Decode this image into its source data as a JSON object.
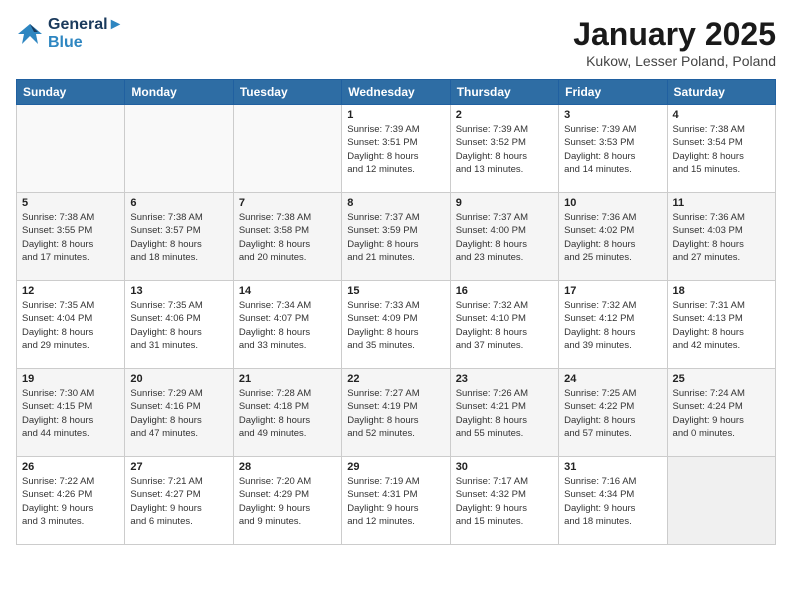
{
  "header": {
    "logo_line1": "General",
    "logo_line2": "Blue",
    "title": "January 2025",
    "subtitle": "Kukow, Lesser Poland, Poland"
  },
  "days_of_week": [
    "Sunday",
    "Monday",
    "Tuesday",
    "Wednesday",
    "Thursday",
    "Friday",
    "Saturday"
  ],
  "weeks": [
    [
      {
        "day": "",
        "info": ""
      },
      {
        "day": "",
        "info": ""
      },
      {
        "day": "",
        "info": ""
      },
      {
        "day": "1",
        "info": "Sunrise: 7:39 AM\nSunset: 3:51 PM\nDaylight: 8 hours\nand 12 minutes."
      },
      {
        "day": "2",
        "info": "Sunrise: 7:39 AM\nSunset: 3:52 PM\nDaylight: 8 hours\nand 13 minutes."
      },
      {
        "day": "3",
        "info": "Sunrise: 7:39 AM\nSunset: 3:53 PM\nDaylight: 8 hours\nand 14 minutes."
      },
      {
        "day": "4",
        "info": "Sunrise: 7:38 AM\nSunset: 3:54 PM\nDaylight: 8 hours\nand 15 minutes."
      }
    ],
    [
      {
        "day": "5",
        "info": "Sunrise: 7:38 AM\nSunset: 3:55 PM\nDaylight: 8 hours\nand 17 minutes."
      },
      {
        "day": "6",
        "info": "Sunrise: 7:38 AM\nSunset: 3:57 PM\nDaylight: 8 hours\nand 18 minutes."
      },
      {
        "day": "7",
        "info": "Sunrise: 7:38 AM\nSunset: 3:58 PM\nDaylight: 8 hours\nand 20 minutes."
      },
      {
        "day": "8",
        "info": "Sunrise: 7:37 AM\nSunset: 3:59 PM\nDaylight: 8 hours\nand 21 minutes."
      },
      {
        "day": "9",
        "info": "Sunrise: 7:37 AM\nSunset: 4:00 PM\nDaylight: 8 hours\nand 23 minutes."
      },
      {
        "day": "10",
        "info": "Sunrise: 7:36 AM\nSunset: 4:02 PM\nDaylight: 8 hours\nand 25 minutes."
      },
      {
        "day": "11",
        "info": "Sunrise: 7:36 AM\nSunset: 4:03 PM\nDaylight: 8 hours\nand 27 minutes."
      }
    ],
    [
      {
        "day": "12",
        "info": "Sunrise: 7:35 AM\nSunset: 4:04 PM\nDaylight: 8 hours\nand 29 minutes."
      },
      {
        "day": "13",
        "info": "Sunrise: 7:35 AM\nSunset: 4:06 PM\nDaylight: 8 hours\nand 31 minutes."
      },
      {
        "day": "14",
        "info": "Sunrise: 7:34 AM\nSunset: 4:07 PM\nDaylight: 8 hours\nand 33 minutes."
      },
      {
        "day": "15",
        "info": "Sunrise: 7:33 AM\nSunset: 4:09 PM\nDaylight: 8 hours\nand 35 minutes."
      },
      {
        "day": "16",
        "info": "Sunrise: 7:32 AM\nSunset: 4:10 PM\nDaylight: 8 hours\nand 37 minutes."
      },
      {
        "day": "17",
        "info": "Sunrise: 7:32 AM\nSunset: 4:12 PM\nDaylight: 8 hours\nand 39 minutes."
      },
      {
        "day": "18",
        "info": "Sunrise: 7:31 AM\nSunset: 4:13 PM\nDaylight: 8 hours\nand 42 minutes."
      }
    ],
    [
      {
        "day": "19",
        "info": "Sunrise: 7:30 AM\nSunset: 4:15 PM\nDaylight: 8 hours\nand 44 minutes."
      },
      {
        "day": "20",
        "info": "Sunrise: 7:29 AM\nSunset: 4:16 PM\nDaylight: 8 hours\nand 47 minutes."
      },
      {
        "day": "21",
        "info": "Sunrise: 7:28 AM\nSunset: 4:18 PM\nDaylight: 8 hours\nand 49 minutes."
      },
      {
        "day": "22",
        "info": "Sunrise: 7:27 AM\nSunset: 4:19 PM\nDaylight: 8 hours\nand 52 minutes."
      },
      {
        "day": "23",
        "info": "Sunrise: 7:26 AM\nSunset: 4:21 PM\nDaylight: 8 hours\nand 55 minutes."
      },
      {
        "day": "24",
        "info": "Sunrise: 7:25 AM\nSunset: 4:22 PM\nDaylight: 8 hours\nand 57 minutes."
      },
      {
        "day": "25",
        "info": "Sunrise: 7:24 AM\nSunset: 4:24 PM\nDaylight: 9 hours\nand 0 minutes."
      }
    ],
    [
      {
        "day": "26",
        "info": "Sunrise: 7:22 AM\nSunset: 4:26 PM\nDaylight: 9 hours\nand 3 minutes."
      },
      {
        "day": "27",
        "info": "Sunrise: 7:21 AM\nSunset: 4:27 PM\nDaylight: 9 hours\nand 6 minutes."
      },
      {
        "day": "28",
        "info": "Sunrise: 7:20 AM\nSunset: 4:29 PM\nDaylight: 9 hours\nand 9 minutes."
      },
      {
        "day": "29",
        "info": "Sunrise: 7:19 AM\nSunset: 4:31 PM\nDaylight: 9 hours\nand 12 minutes."
      },
      {
        "day": "30",
        "info": "Sunrise: 7:17 AM\nSunset: 4:32 PM\nDaylight: 9 hours\nand 15 minutes."
      },
      {
        "day": "31",
        "info": "Sunrise: 7:16 AM\nSunset: 4:34 PM\nDaylight: 9 hours\nand 18 minutes."
      },
      {
        "day": "",
        "info": ""
      }
    ]
  ]
}
